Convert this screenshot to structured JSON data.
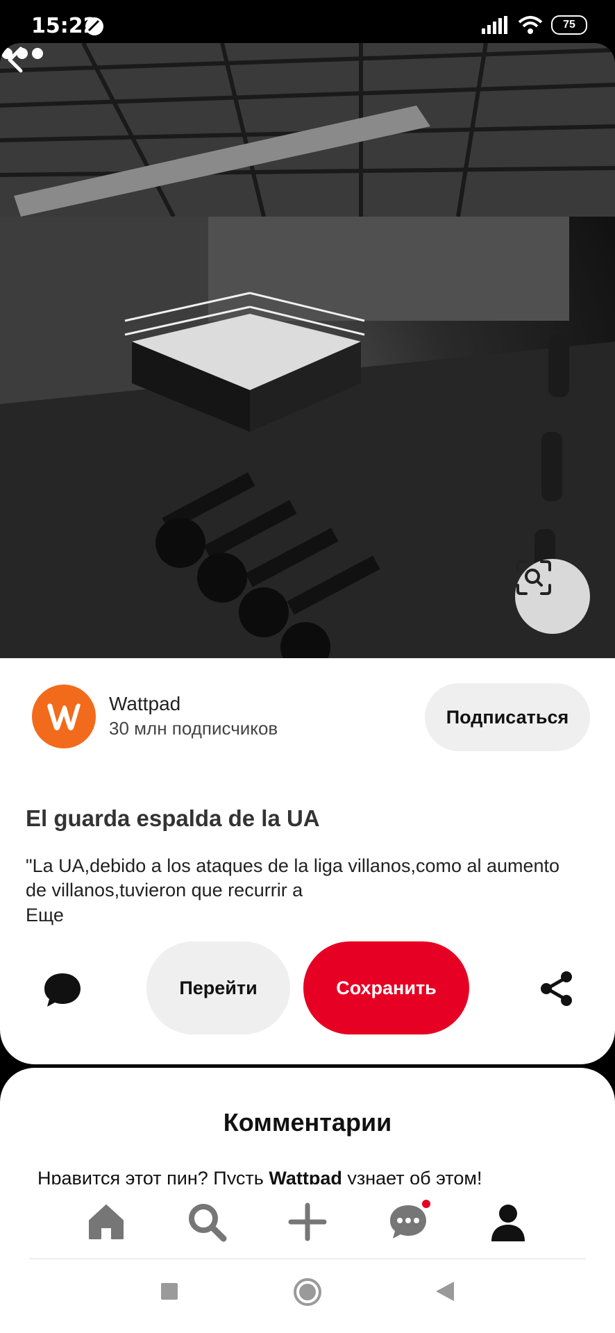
{
  "status": {
    "time": "15:22",
    "battery": "75"
  },
  "hero": {
    "back_icon": "chevron-left-icon",
    "more_icon": "more-horizontal-icon",
    "lens_icon": "visual-search-icon"
  },
  "creator": {
    "name": "Wattpad",
    "followers": "30 млн подписчиков",
    "follow_label": "Подписаться",
    "logo_letter": "w",
    "brand_color": "#f26a1b"
  },
  "pin": {
    "title": "El guarda espalda de la UA",
    "description": "\"La UA,debido a los ataques de la liga villanos,como al aumento de villanos,tuvieron que recurrir a",
    "more_label": "Еще"
  },
  "actions": {
    "go_label": "Перейти",
    "save_label": "Сохранить",
    "save_color": "#e60023"
  },
  "comments": {
    "title": "Комментарии",
    "hint_prefix": "Нравится этот пин? Пусть ",
    "hint_bold": "Wattpad",
    "hint_suffix": " узнает об этом!"
  },
  "nav": {
    "items": [
      "home-icon",
      "search-icon",
      "plus-icon",
      "messages-icon",
      "profile-icon"
    ]
  }
}
